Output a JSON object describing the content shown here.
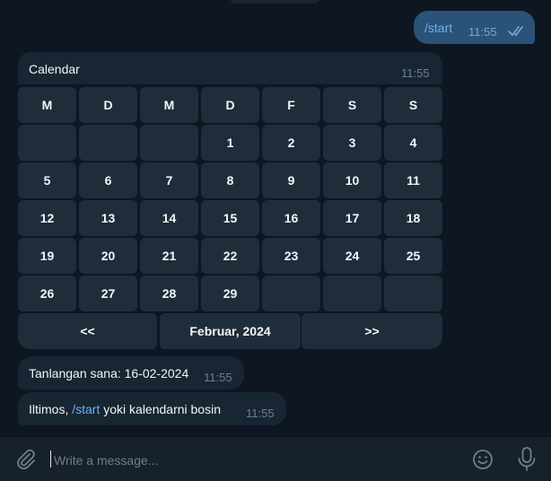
{
  "outgoing": {
    "text": "/start",
    "time": "11:55"
  },
  "calendar": {
    "title": "Calendar",
    "time": "11:55",
    "weekdays": [
      "M",
      "D",
      "M",
      "D",
      "F",
      "S",
      "S"
    ],
    "weeks": [
      [
        "",
        "",
        "",
        "1",
        "2",
        "3",
        "4"
      ],
      [
        "5",
        "6",
        "7",
        "8",
        "9",
        "10",
        "11"
      ],
      [
        "12",
        "13",
        "14",
        "15",
        "16",
        "17",
        "18"
      ],
      [
        "19",
        "20",
        "21",
        "22",
        "23",
        "24",
        "25"
      ],
      [
        "26",
        "27",
        "28",
        "29",
        "",
        "",
        ""
      ]
    ],
    "nav": {
      "prev": "<<",
      "month": "Februar, 2024",
      "next": ">>"
    }
  },
  "messages": [
    {
      "text": "Tanlangan sana: 16-02-2024",
      "time": "11:55"
    },
    {
      "text_before": "Iltimos, ",
      "link": "/start",
      "text_after": " yoki kalendarni bosin",
      "time": "11:55"
    }
  ],
  "composer": {
    "placeholder": "Write a message..."
  },
  "icons": {
    "attach": "paperclip-icon",
    "emoji": "smiley-icon",
    "mic": "microphone-icon",
    "read": "double-check-icon"
  },
  "colors": {
    "background": "#0e1621",
    "bubble_in": "#182533",
    "bubble_out": "#2b5278",
    "accent": "#6ab3f3",
    "button": "#1f2d3b"
  }
}
